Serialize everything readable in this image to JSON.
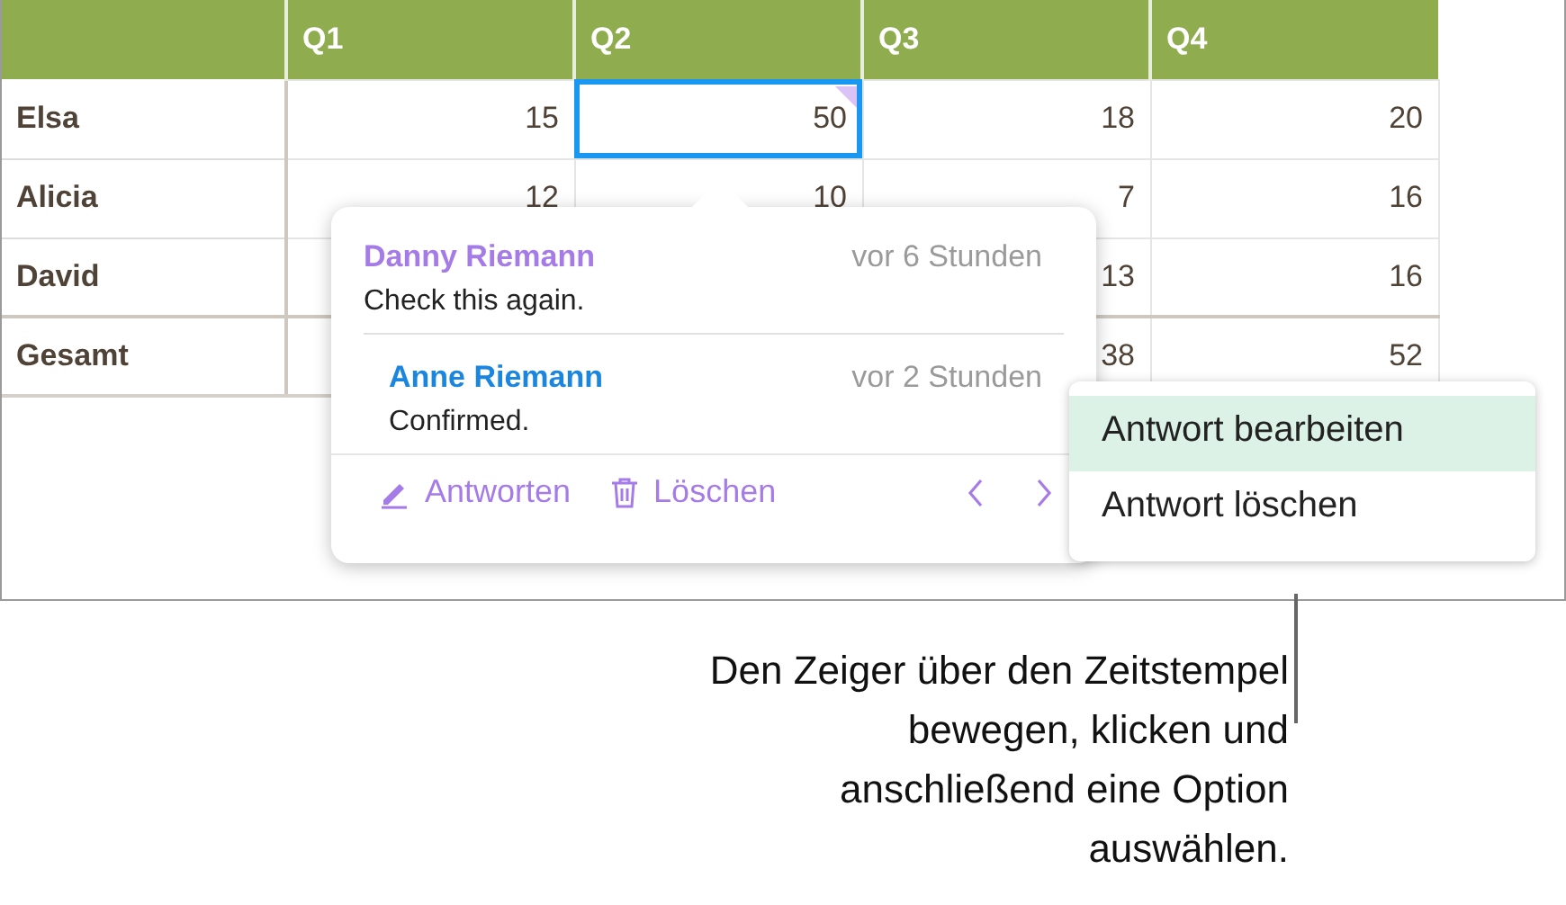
{
  "table": {
    "columns": [
      "Q1",
      "Q2",
      "Q3",
      "Q4"
    ],
    "rows": [
      {
        "name": "Elsa",
        "cells": [
          {
            "text": "15",
            "selected": false,
            "comment": false
          },
          {
            "text": "50",
            "selected": true,
            "comment": true
          },
          {
            "text": "18",
            "selected": false,
            "comment": false
          },
          {
            "text": "20",
            "selected": false,
            "comment": false
          }
        ]
      },
      {
        "name": "Alicia",
        "cells": [
          {
            "text": "12",
            "selected": false,
            "comment": false
          },
          {
            "text": "10",
            "selected": false,
            "comment": false
          },
          {
            "text": "7",
            "selected": false,
            "comment": false
          },
          {
            "text": "16",
            "selected": false,
            "comment": false
          }
        ]
      },
      {
        "name": "David",
        "cells": [
          null,
          null,
          {
            "text": "13",
            "selected": false,
            "comment": false
          },
          {
            "text": "16",
            "selected": false,
            "comment": false
          }
        ]
      },
      {
        "name": "Gesamt",
        "cells": [
          null,
          null,
          {
            "text": "38",
            "selected": false,
            "comment": false
          },
          {
            "text": "52",
            "selected": false,
            "comment": false
          }
        ]
      }
    ]
  },
  "comment_popover": {
    "entries": [
      {
        "kind": "comment",
        "author": "Danny Riemann",
        "color": "#a57be8",
        "time": "vor 6 Stunden",
        "text": "Check this again."
      },
      {
        "kind": "reply",
        "author": "Anne Riemann",
        "color": "#1a86e0",
        "time": "vor 2 Stunden",
        "text": "Confirmed."
      }
    ],
    "actions": [
      {
        "kind": "reply",
        "label": "Antworten"
      },
      {
        "kind": "delete",
        "label": "Löschen"
      }
    ]
  },
  "context_menu": {
    "items": [
      {
        "label": "Antwort bearbeiten",
        "selected": true
      },
      {
        "label": "Antwort löschen",
        "selected": false
      }
    ]
  },
  "caption": "Den Zeiger über den Zeitstempel bewegen, klicken und anschließend eine Option auswählen."
}
